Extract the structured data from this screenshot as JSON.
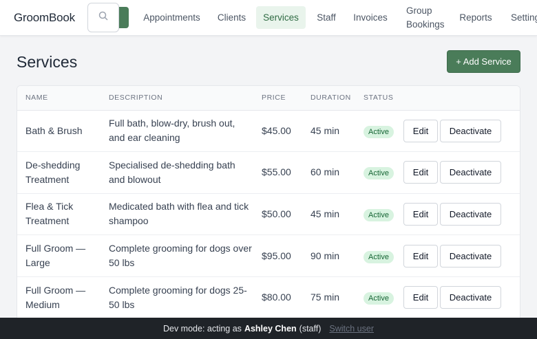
{
  "app": {
    "brand": "GroomBook"
  },
  "search": {
    "placeholder": ""
  },
  "nav": {
    "items": [
      "Appointments",
      "Clients",
      "Services",
      "Staff",
      "Invoices",
      "Group Bookings",
      "Reports",
      "Settings"
    ],
    "active": "Services"
  },
  "page": {
    "title": "Services",
    "add_button": "+ Add Service"
  },
  "table": {
    "headers": [
      "Name",
      "Description",
      "Price",
      "Duration",
      "Status"
    ],
    "rows": [
      {
        "name": "Bath & Brush",
        "description": "Full bath, blow-dry, brush out, and ear cleaning",
        "price": "$45.00",
        "duration": "45 min",
        "status": "Active"
      },
      {
        "name": "De-shedding Treatment",
        "description": "Specialised de-shedding bath and blowout",
        "price": "$55.00",
        "duration": "60 min",
        "status": "Active"
      },
      {
        "name": "Flea & Tick Treatment",
        "description": "Medicated bath with flea and tick shampoo",
        "price": "$50.00",
        "duration": "45 min",
        "status": "Active"
      },
      {
        "name": "Full Groom — Large",
        "description": "Complete grooming for dogs over 50 lbs",
        "price": "$95.00",
        "duration": "90 min",
        "status": "Active"
      },
      {
        "name": "Full Groom — Medium",
        "description": "Complete grooming for dogs 25-50 lbs",
        "price": "$80.00",
        "duration": "75 min",
        "status": "Active"
      }
    ],
    "edit_label": "Edit",
    "deactivate_label": "Deactivate"
  },
  "devbar": {
    "prefix": "Dev mode: acting as",
    "user": "Ashley Chen",
    "role": "(staff)",
    "switch_label": "Switch user"
  },
  "colors": {
    "accent": "#4a7c59",
    "active_nav_bg": "#e9f4ec",
    "badge_bg": "#d8f3e0",
    "devbar_bg": "#1f2328"
  },
  "icons": {
    "search": "search-icon"
  }
}
